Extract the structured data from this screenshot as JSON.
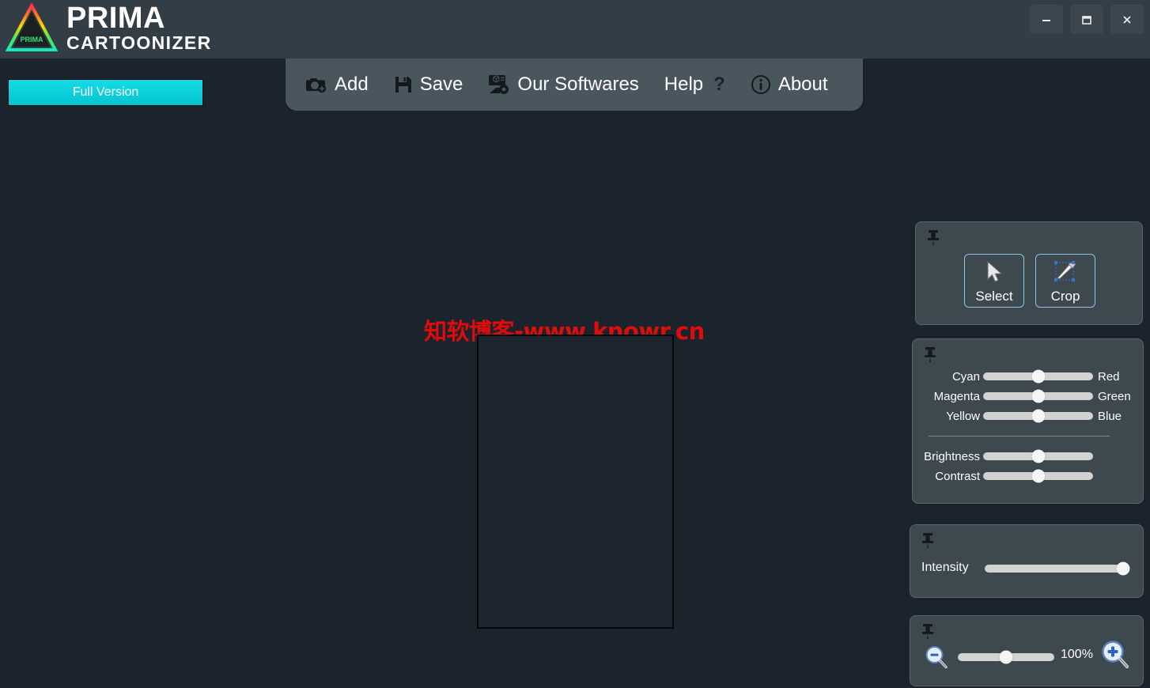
{
  "app": {
    "brand_line1": "PRIMA",
    "brand_line2": "CARTOONIZER",
    "logo_inner_text": "PRIMA",
    "accent_cyan": "#0fd2dd",
    "titlebar_bg": "#333d45",
    "canvas_bg": "#1b242c",
    "panel_bg": "#3d484f",
    "panel_border": "#59666e",
    "tab_bg": "#4a565e",
    "watermark_color": "#e00b0b"
  },
  "window_controls": {
    "minimize": "minimize",
    "maximize": "maximize",
    "close": "close"
  },
  "full_version": {
    "label": "Full Version"
  },
  "menu": {
    "items": [
      {
        "label": "Add",
        "icon": "camera-add-icon"
      },
      {
        "label": "Save",
        "icon": "floppy-disk-icon"
      },
      {
        "label": "Our Softwares",
        "icon": "software-box-icon"
      },
      {
        "label": "Help",
        "icon": "question-mark-icon",
        "suffix": "?"
      },
      {
        "label": "About",
        "icon": "info-circle-icon"
      }
    ]
  },
  "canvas": {
    "watermark": "知软博客-www.knowr.cn"
  },
  "tools_panel": {
    "pin_icon": "pushpin-icon",
    "buttons": [
      {
        "label": "Select",
        "icon": "cursor-arrow-icon"
      },
      {
        "label": "Crop",
        "icon": "crop-pen-icon"
      }
    ]
  },
  "color_panel": {
    "pin_icon": "pushpin-icon",
    "rows": [
      {
        "left": "Cyan",
        "right": "Red",
        "value": 50
      },
      {
        "left": "Magenta",
        "right": "Green",
        "value": 50
      },
      {
        "left": "Yellow",
        "right": "Blue",
        "value": 50
      }
    ],
    "adjust": [
      {
        "left": "Brightness",
        "right": "",
        "value": 50
      },
      {
        "left": "Contrast",
        "right": "",
        "value": 50
      }
    ]
  },
  "intensity_panel": {
    "pin_icon": "pushpin-icon",
    "label": "Intensity",
    "value": 100
  },
  "zoom_panel": {
    "pin_icon": "pushpin-icon",
    "zoom_out_icon": "magnifier-minus-icon",
    "zoom_in_icon": "magnifier-plus-icon",
    "percent_label": "100%",
    "value": 50
  }
}
